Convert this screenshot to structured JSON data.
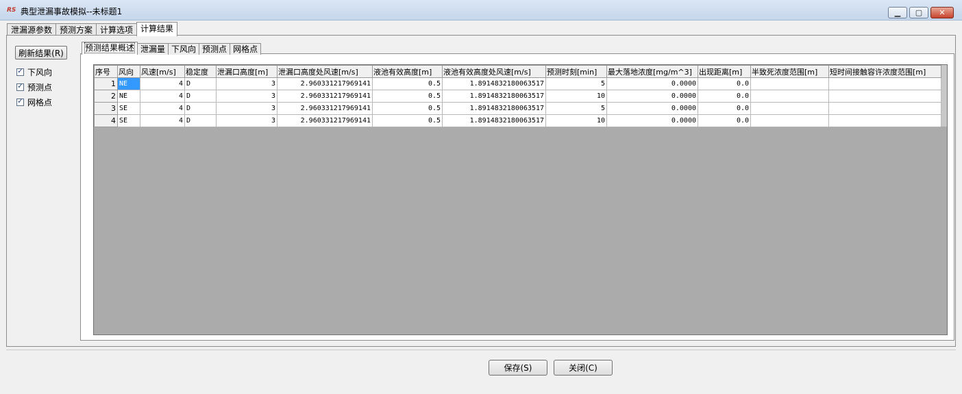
{
  "window": {
    "title": "典型泄漏事故模拟--未标题1",
    "icon": "app-logo-icon",
    "controls": {
      "minimize": "▁",
      "maximize": "▢",
      "close": "✕"
    }
  },
  "main_tabs": [
    "泄漏源参数",
    "预测方案",
    "计算选项",
    "计算结果"
  ],
  "active_main_tab": "计算结果",
  "left_panel": {
    "refresh_label": "刷新结果(R)",
    "checkboxes": [
      {
        "label": "下风向",
        "checked": true
      },
      {
        "label": "预测点",
        "checked": true
      },
      {
        "label": "网格点",
        "checked": true
      }
    ]
  },
  "sub_tabs": [
    "预测结果概述",
    "泄漏量",
    "下风向",
    "预测点",
    "网格点"
  ],
  "active_sub_tab": "预测结果概述",
  "table": {
    "columns": [
      "序号",
      "风向",
      "风速[m/s]",
      "稳定度",
      "泄漏口高度[m]",
      "泄漏口高度处风速[m/s]",
      "液池有效高度[m]",
      "液池有效高度处风速[m/s]",
      "预测时刻[min]",
      "最大落地浓度[mg/m^3]",
      "出现距离[m]",
      "半致死浓度范围[m]",
      "短时间接触容许浓度范围[m]"
    ],
    "rows": [
      [
        "1",
        "NE",
        "4",
        "D",
        "3",
        "2.960331217969141",
        "0.5",
        "1.891483218006351​7",
        "5",
        "0.0000",
        "0.0",
        "",
        ""
      ],
      [
        "2",
        "NE",
        "4",
        "D",
        "3",
        "2.960331217969141",
        "0.5",
        "1.891483218006351​7",
        "10",
        "0.0000",
        "0.0",
        "",
        ""
      ],
      [
        "3",
        "SE",
        "4",
        "D",
        "3",
        "2.960331217969141",
        "0.5",
        "1.891483218006351​7",
        "5",
        "0.0000",
        "0.0",
        "",
        ""
      ],
      [
        "4",
        "SE",
        "4",
        "D",
        "3",
        "2.960331217969141",
        "0.5",
        "1.891483218006351​7",
        "10",
        "0.0000",
        "0.0",
        "",
        ""
      ]
    ]
  },
  "buttons": {
    "save": "保存(S)",
    "close": "关闭(C)"
  }
}
